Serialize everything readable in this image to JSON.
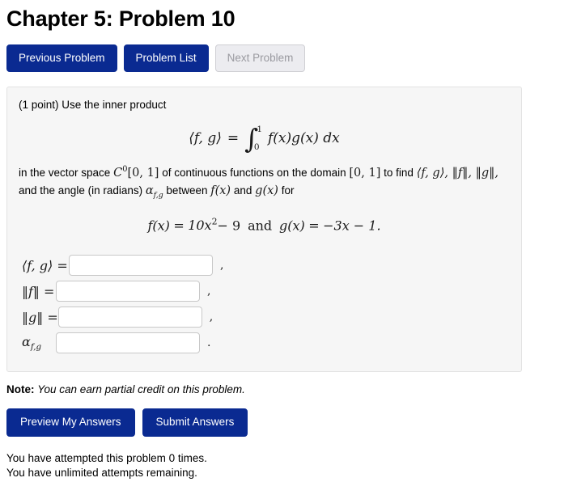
{
  "header": {
    "title": "Chapter 5: Problem 10"
  },
  "nav": {
    "previous_label": "Previous Problem",
    "list_label": "Problem List",
    "next_label": "Next Problem",
    "next_disabled": true
  },
  "problem": {
    "points_text": "(1 point)",
    "intro_text": "Use the inner product",
    "inner_product_formula": {
      "lhs": "⟨f, g⟩",
      "equals": "=",
      "integral_lower": "0",
      "integral_upper": "1",
      "integrand": "f(x)g(x) dx"
    },
    "vector_space_text_1": "in the vector space",
    "vector_space_symbol": "C",
    "vector_space_superscript": "0",
    "vector_space_domain": "[0, 1]",
    "vector_space_text_2": "of continuous functions on the domain",
    "domain_symbol": "[0, 1]",
    "vector_space_text_3": "to find",
    "find_items": "⟨f, g⟩, ‖f‖, ‖g‖,",
    "angle_text_1": "and the angle (in radians)",
    "angle_symbol": "α",
    "angle_subscript": "f,g",
    "angle_text_2": "between",
    "angle_f": "f(x)",
    "angle_and": "and",
    "angle_g": "g(x)",
    "angle_text_3": "for",
    "functions": {
      "f_label": "f(x)",
      "f_equals": "=",
      "f_coeff": "10x",
      "f_power": "2",
      "f_rest": "− 9",
      "conjunction": "and",
      "g_label": "g(x)",
      "g_equals": "=",
      "g_expr": "−3x − 1."
    }
  },
  "answers": [
    {
      "label": "⟨f, g⟩",
      "equals": "=",
      "value": "",
      "placeholder": "",
      "punctuation": ","
    },
    {
      "label": "‖f‖",
      "equals": "=",
      "value": "",
      "placeholder": "",
      "punctuation": ","
    },
    {
      "label": "‖g‖",
      "equals": "=",
      "value": "",
      "placeholder": "",
      "punctuation": ","
    },
    {
      "label": "α",
      "sublabel": "f,g",
      "equals": "",
      "value": "",
      "placeholder": "",
      "punctuation": "."
    }
  ],
  "note": {
    "prefix": "Note:",
    "text": "You can earn partial credit on this problem."
  },
  "actions": {
    "preview_label": "Preview My Answers",
    "submit_label": "Submit Answers"
  },
  "status": {
    "attempted_line": "You have attempted this problem 0 times.",
    "remaining_line": "You have unlimited attempts remaining."
  },
  "colors": {
    "primary_button": "#0a2a91",
    "disabled_button_bg": "#ececf0",
    "disabled_button_text": "#9a9aa0",
    "panel_bg": "#f6f6f6",
    "panel_border": "#e2e2e2"
  }
}
